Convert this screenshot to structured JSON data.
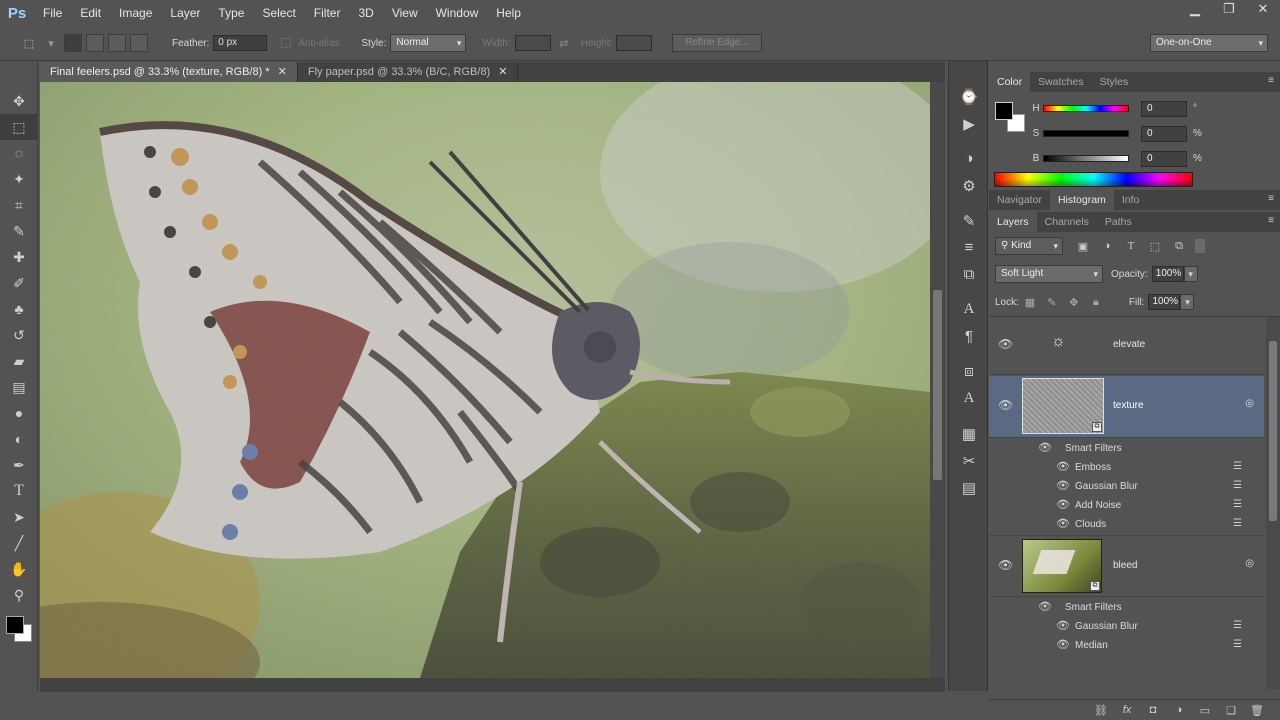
{
  "app": {
    "logo": "Ps"
  },
  "menu": [
    "File",
    "Edit",
    "Image",
    "Layer",
    "Type",
    "Select",
    "Filter",
    "3D",
    "View",
    "Window",
    "Help"
  ],
  "window_controls": [
    "minimize-icon",
    "restore-icon",
    "close-icon"
  ],
  "options": {
    "feather_label": "Feather:",
    "feather_value": "0 px",
    "antialias_label": "Anti-alias",
    "style_label": "Style:",
    "style_value": "Normal",
    "width_label": "Width:",
    "height_label": "Height:",
    "refine_edge": "Refine Edge...",
    "workspace": "One-on-One"
  },
  "tabs": [
    {
      "label": "Final feelers.psd @ 33.3% (texture, RGB/8) *",
      "active": true
    },
    {
      "label": "Fly paper.psd @ 33.3% (B/C, RGB/8)",
      "active": false
    }
  ],
  "tools": [
    "move-tool-icon",
    "marquee-tool-icon",
    "lasso-tool-icon",
    "magic-wand-icon",
    "crop-tool-icon",
    "eyedropper-icon",
    "healing-brush-icon",
    "brush-tool-icon",
    "clone-stamp-icon",
    "history-brush-icon",
    "eraser-icon",
    "gradient-tool-icon",
    "blur-tool-icon",
    "dodge-tool-icon",
    "pen-tool-icon",
    "type-tool-icon",
    "path-selection-icon",
    "line-tool-icon",
    "hand-tool-icon",
    "zoom-tool-icon"
  ],
  "color_panel": {
    "tabs": [
      "Color",
      "Swatches",
      "Styles"
    ],
    "rows": [
      {
        "label": "H",
        "value": "0",
        "unit": "°"
      },
      {
        "label": "S",
        "value": "0",
        "unit": "%"
      },
      {
        "label": "B",
        "value": "0",
        "unit": "%"
      }
    ],
    "foreground": "#000000",
    "background": "#ffffff"
  },
  "nav_panel": {
    "tabs": [
      "Navigator",
      "Histogram",
      "Info"
    ],
    "active": "Histogram"
  },
  "layers_panel": {
    "tabs": [
      "Layers",
      "Channels",
      "Paths"
    ],
    "filter_kind": "Kind",
    "blend_mode": "Soft Light",
    "opacity_label": "Opacity:",
    "opacity_value": "100%",
    "lock_label": "Lock:",
    "fill_label": "Fill:",
    "fill_value": "100%",
    "layers": [
      {
        "name": "elevate"
      },
      {
        "name": "texture",
        "smart_filters_label": "Smart Filters",
        "filters": [
          "Emboss",
          "Gaussian Blur",
          "Add Noise",
          "Clouds"
        ]
      },
      {
        "name": "bleed",
        "smart_filters_label": "Smart Filters",
        "filters": [
          "Gaussian Blur",
          "Median"
        ]
      }
    ]
  }
}
